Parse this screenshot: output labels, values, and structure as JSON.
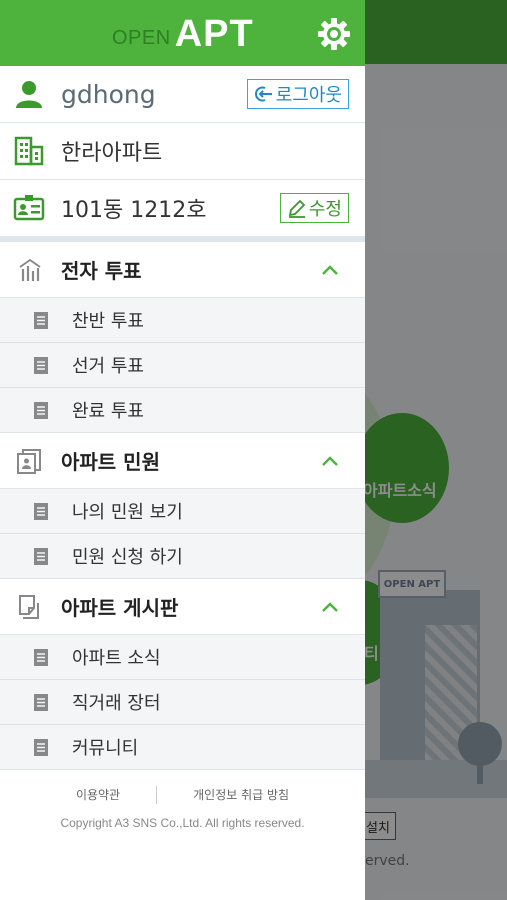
{
  "background": {
    "circle1_label": "아파트소식",
    "circle2_label": "티",
    "sign_label": "OPEN APT",
    "install_label": "설치",
    "reserved_text": "erved."
  },
  "header": {
    "logo_open": "OPEN",
    "logo_apt": "APT",
    "settings_icon": "gear-icon",
    "color": "#4db33d"
  },
  "user": {
    "name": "gdhong",
    "logout_label": "로그아웃",
    "apartment": "한라아파트",
    "unit": "101동 1212호",
    "edit_label": "수정"
  },
  "sections": [
    {
      "title": "전자 투표",
      "icon": "chart-icon",
      "items": [
        "찬반 투표",
        "선거 투표",
        "완료 투표"
      ]
    },
    {
      "title": "아파트 민원",
      "icon": "document-stack-icon",
      "items": [
        "나의 민원 보기",
        "민원 신청 하기"
      ]
    },
    {
      "title": "아파트 게시판",
      "icon": "board-icon",
      "items": [
        "아파트 소식",
        "직거래 장터",
        "커뮤니티"
      ]
    }
  ],
  "footer": {
    "terms": "이용약관",
    "privacy": "개인정보 취급 방침",
    "copyright": "Copyright A3 SNS Co.,Ltd.  All rights reserved."
  }
}
